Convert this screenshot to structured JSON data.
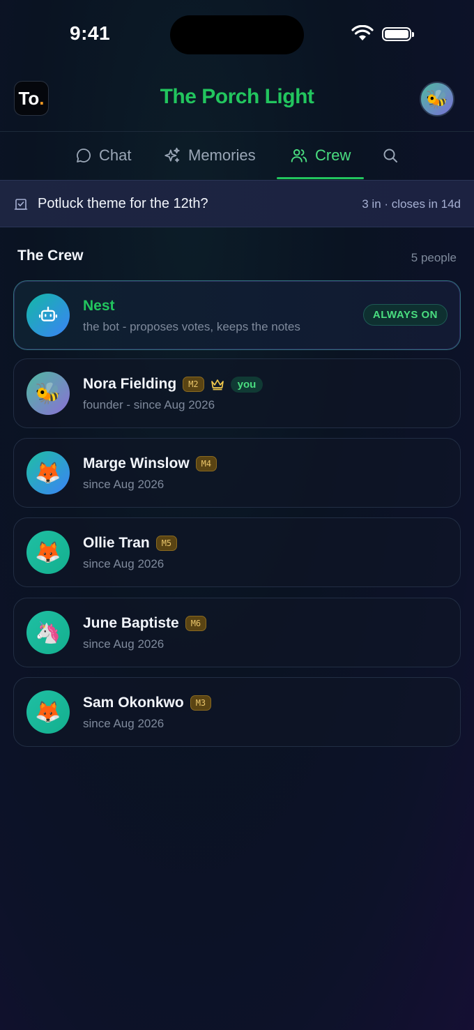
{
  "status": {
    "time": "9:41"
  },
  "header": {
    "logo_text": "To",
    "logo_dot": ".",
    "title": "The Porch Light",
    "avatar_emoji": "🐝"
  },
  "tabs": [
    {
      "label": "Chat",
      "icon": "chat-bubble-icon",
      "active": false
    },
    {
      "label": "Memories",
      "icon": "sparkles-icon",
      "active": false
    },
    {
      "label": "Crew",
      "icon": "people-icon",
      "active": true
    },
    {
      "label": "",
      "icon": "search-icon",
      "active": false
    }
  ],
  "vote": {
    "icon": "ballot-box-icon",
    "text": "Potluck theme for the 12th?",
    "meta": "3 in · closes in 14d"
  },
  "crew": {
    "title": "The Crew",
    "count": "5 people",
    "bot": {
      "name": "Nest",
      "subtitle": "the bot - proposes votes, keeps the notes",
      "status": "ALWAYS ON",
      "icon": "robot-icon"
    },
    "members": [
      {
        "name": "Nora Fielding",
        "badge": "M2",
        "crown": true,
        "you": "you",
        "subtitle": "founder - since Aug 2026",
        "emoji": "🐝"
      },
      {
        "name": "Marge Winslow",
        "badge": "M4",
        "subtitle": "since Aug 2026",
        "emoji": "🦊"
      },
      {
        "name": "Ollie Tran",
        "badge": "M5",
        "subtitle": "since Aug 2026",
        "emoji": "🦊"
      },
      {
        "name": "June Baptiste",
        "badge": "M6",
        "subtitle": "since Aug 2026",
        "emoji": "🦄"
      },
      {
        "name": "Sam Okonkwo",
        "badge": "M3",
        "subtitle": "since Aug 2026",
        "emoji": "🦊"
      }
    ]
  },
  "colors": {
    "accent": "#22c55e",
    "badge": "#e8c46a",
    "background": "#0a1322"
  }
}
